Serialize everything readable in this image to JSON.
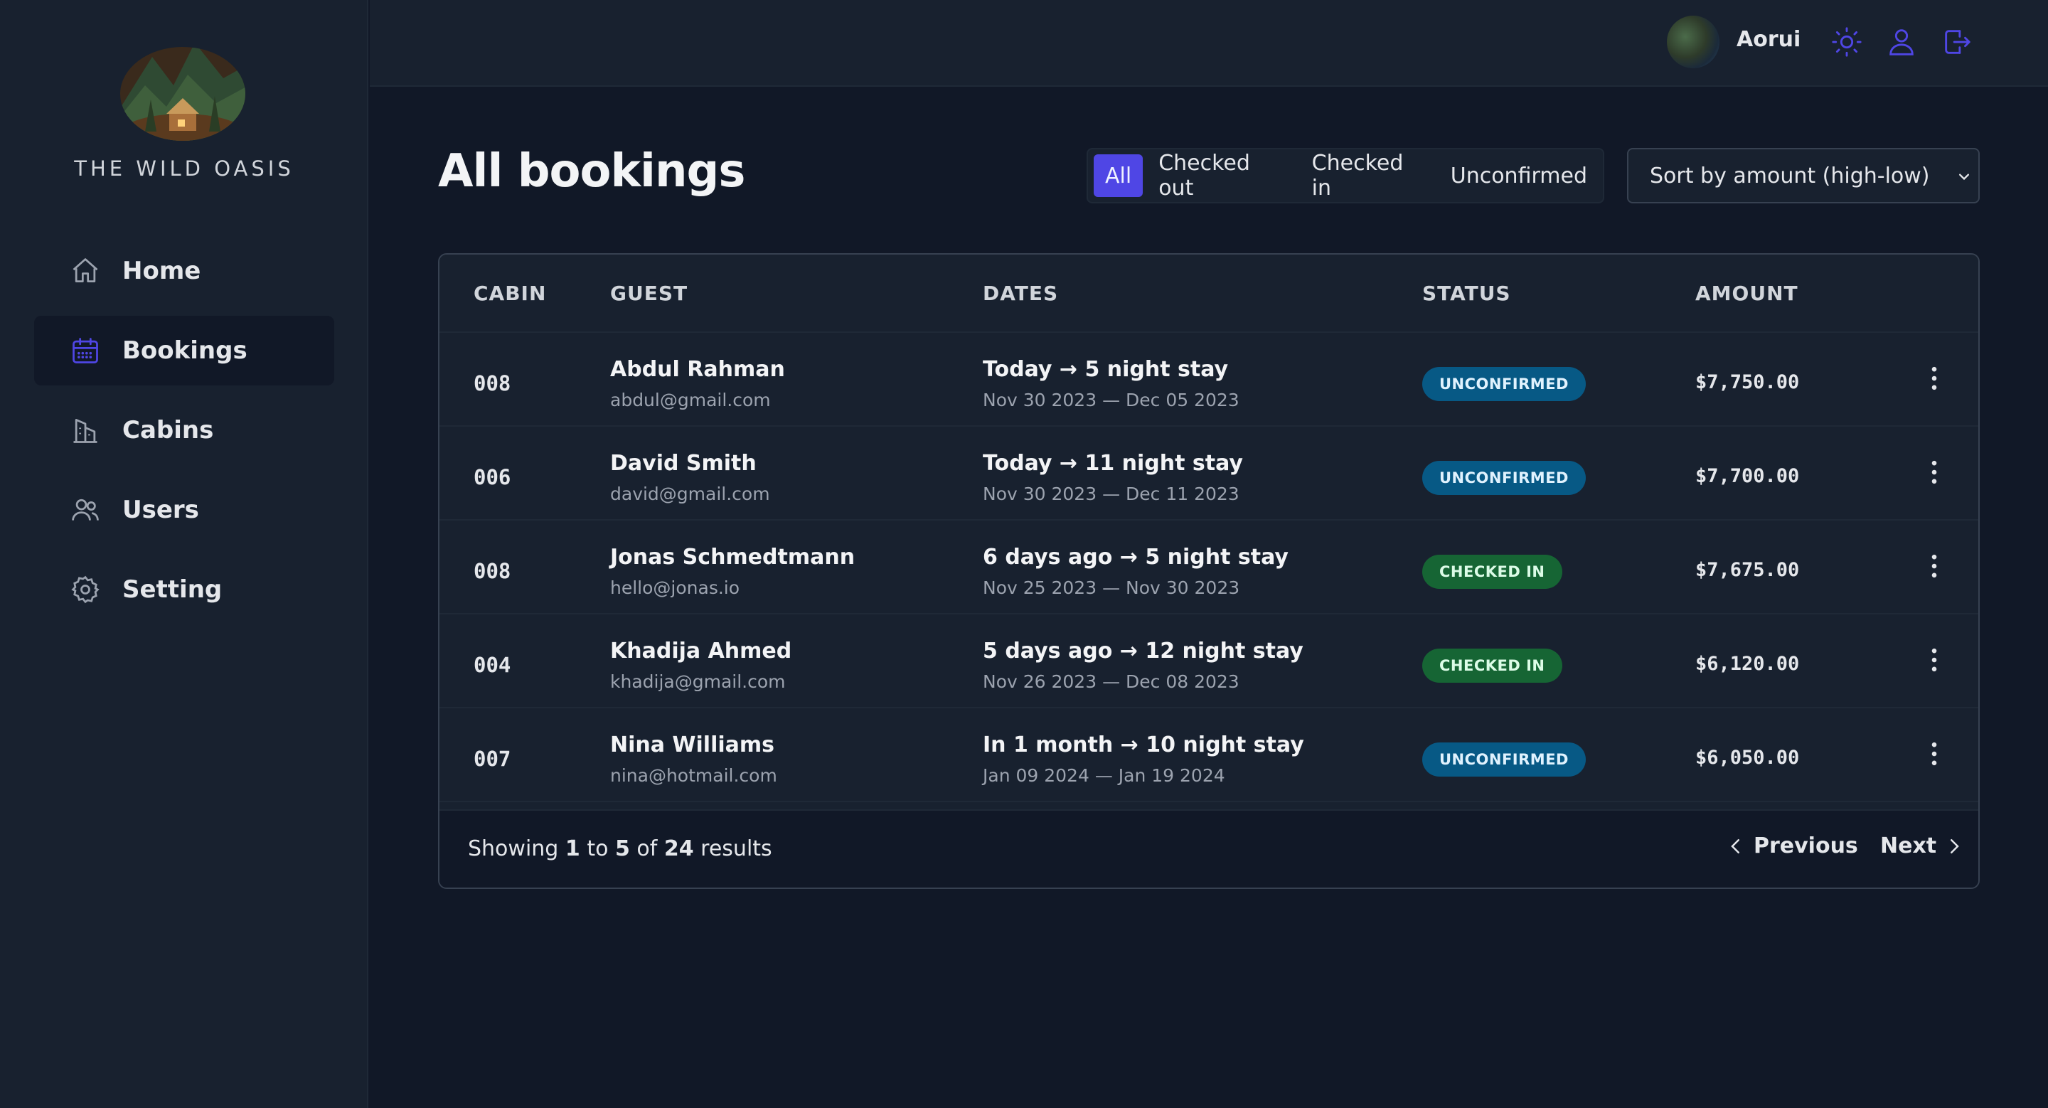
{
  "brand": {
    "name": "THE WILD OASIS"
  },
  "sidebar": {
    "items": [
      {
        "label": "Home",
        "icon": "home-icon",
        "active": false
      },
      {
        "label": "Bookings",
        "icon": "calendar-icon",
        "active": true
      },
      {
        "label": "Cabins",
        "icon": "building-icon",
        "active": false
      },
      {
        "label": "Users",
        "icon": "users-icon",
        "active": false
      },
      {
        "label": "Setting",
        "icon": "gear-icon",
        "active": false
      }
    ]
  },
  "header": {
    "username": "Aorui",
    "icons": [
      "sun-icon",
      "user-icon",
      "logout-icon"
    ],
    "accent": "#4f46e5"
  },
  "main": {
    "title": "All bookings",
    "filters": [
      "All",
      "Checked out",
      "Checked in",
      "Unconfirmed"
    ],
    "active_filter": "All",
    "sort": {
      "selected": "Sort by amount (high-low)"
    }
  },
  "table": {
    "columns": [
      "CABIN",
      "GUEST",
      "DATES",
      "STATUS",
      "AMOUNT"
    ],
    "rows": [
      {
        "cabin": "008",
        "guest": "Abdul Rahman",
        "email": "abdul@gmail.com",
        "stay": "Today → 5 night stay",
        "range": "Nov 30 2023 — Dec 05 2023",
        "status": "UNCONFIRMED",
        "amount": "$7,750.00"
      },
      {
        "cabin": "006",
        "guest": "David Smith",
        "email": "david@gmail.com",
        "stay": "Today → 11 night stay",
        "range": "Nov 30 2023 — Dec 11 2023",
        "status": "UNCONFIRMED",
        "amount": "$7,700.00"
      },
      {
        "cabin": "008",
        "guest": "Jonas Schmedtmann",
        "email": "hello@jonas.io",
        "stay": "6 days ago → 5 night stay",
        "range": "Nov 25 2023 — Nov 30 2023",
        "status": "CHECKED IN",
        "amount": "$7,675.00"
      },
      {
        "cabin": "004",
        "guest": "Khadija Ahmed",
        "email": "khadija@gmail.com",
        "stay": "5 days ago → 12 night stay",
        "range": "Nov 26 2023 — Dec 08 2023",
        "status": "CHECKED IN",
        "amount": "$6,120.00"
      },
      {
        "cabin": "007",
        "guest": "Nina Williams",
        "email": "nina@hotmail.com",
        "stay": "In 1 month → 10 night stay",
        "range": "Jan 09 2024 — Jan 19 2024",
        "status": "UNCONFIRMED",
        "amount": "$6,050.00"
      }
    ],
    "footer": {
      "showing_prefix": "Showing",
      "from": "1",
      "to_word": "to",
      "to": "5",
      "of_word": "of",
      "total": "24",
      "suffix": "results",
      "previous": "Previous",
      "next": "Next"
    }
  },
  "colors": {
    "unconfirmed": "#075985",
    "checked_in": "#166534",
    "background": "#111827",
    "surface": "#18212f"
  }
}
